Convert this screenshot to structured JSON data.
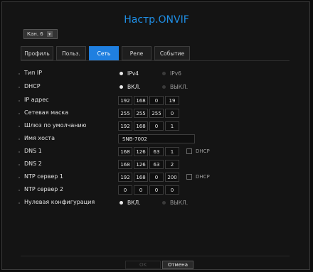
{
  "title": "Настр.ONVIF",
  "channel": {
    "label": "Кан. 6"
  },
  "tabs": [
    {
      "label": "Профиль",
      "active": false
    },
    {
      "label": "Польз.",
      "active": false
    },
    {
      "label": "Сеть",
      "active": true
    },
    {
      "label": "Реле",
      "active": false
    },
    {
      "label": "Событие",
      "active": false
    }
  ],
  "fields": {
    "ip_type": {
      "label": "Тип IP",
      "opt1": "IPv4",
      "opt2": "IPv6",
      "selected": "IPv4"
    },
    "dhcp": {
      "label": "DHCP",
      "opt1": "ВКЛ.",
      "opt2": "ВЫКЛ.",
      "selected": "ВКЛ."
    },
    "ip_address": {
      "label": "IP адрес",
      "octets": [
        "192",
        "168",
        "0",
        "19"
      ]
    },
    "netmask": {
      "label": "Сетевая маска",
      "octets": [
        "255",
        "255",
        "255",
        "0"
      ]
    },
    "gateway": {
      "label": "Шлюз по умолчанию",
      "octets": [
        "192",
        "168",
        "0",
        "1"
      ]
    },
    "hostname": {
      "label": "Имя хоста",
      "value": "SNB-7002"
    },
    "dns1": {
      "label": "DNS 1",
      "octets": [
        "168",
        "126",
        "63",
        "1"
      ],
      "dhcp_label": "DHCP"
    },
    "dns2": {
      "label": "DNS 2",
      "octets": [
        "168",
        "126",
        "63",
        "2"
      ]
    },
    "ntp1": {
      "label": "NTP сервер 1",
      "octets": [
        "192",
        "168",
        "0",
        "200"
      ],
      "dhcp_label": "DHCP"
    },
    "ntp2": {
      "label": "NTP сервер 2",
      "octets": [
        "0",
        "0",
        "0",
        "0"
      ]
    },
    "zeroconf": {
      "label": "Нулевая конфигурация",
      "opt1": "ВКЛ.",
      "opt2": "ВЫКЛ.",
      "selected": "ВКЛ."
    }
  },
  "buttons": {
    "ok": "OK",
    "cancel": "Отмена"
  },
  "colors": {
    "accent": "#1f8fe6",
    "tab_active": "#1f7fe0"
  }
}
